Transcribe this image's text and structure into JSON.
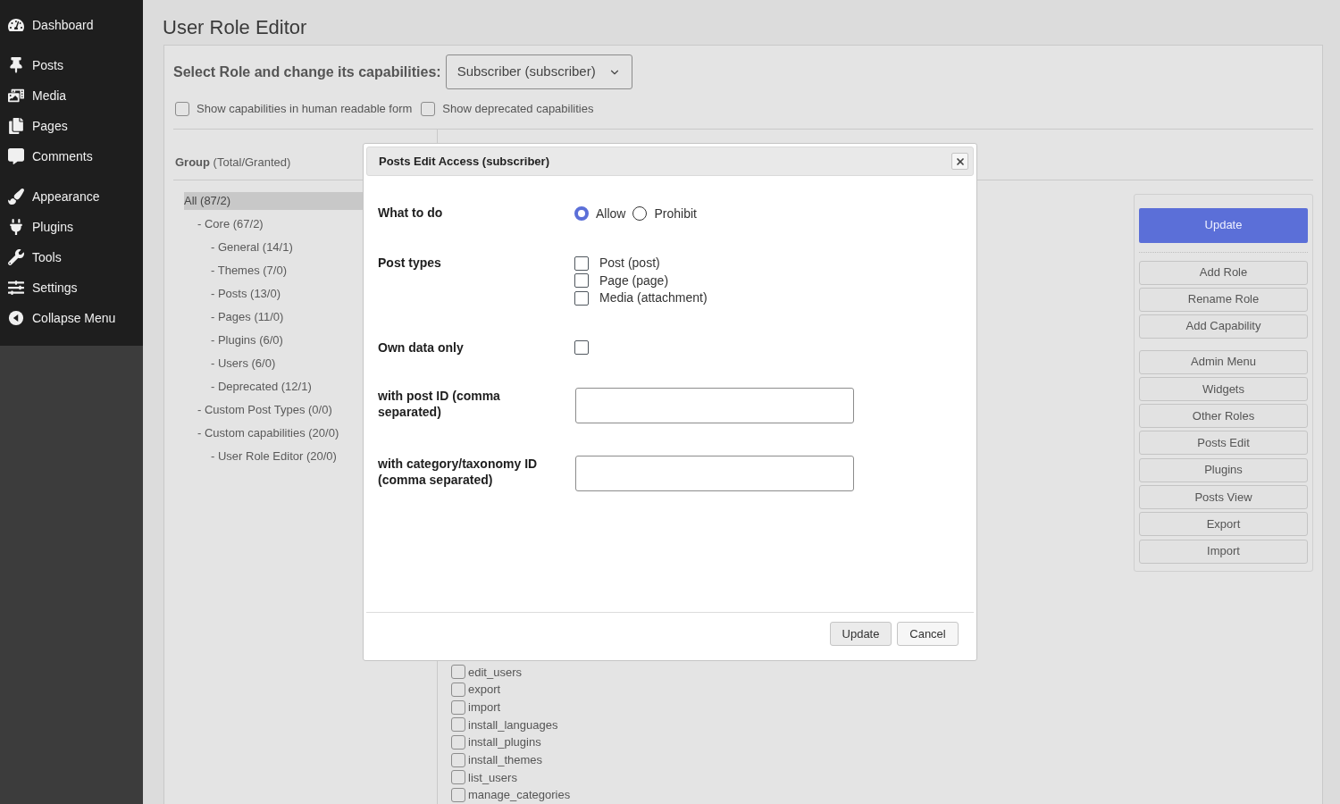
{
  "sidebar": {
    "sections": [
      {
        "items": [
          {
            "label": "Dashboard"
          }
        ]
      },
      {
        "items": [
          {
            "label": "Posts"
          },
          {
            "label": "Media"
          },
          {
            "label": "Pages"
          },
          {
            "label": "Comments"
          }
        ]
      },
      {
        "items": [
          {
            "label": "Appearance"
          },
          {
            "label": "Plugins"
          },
          {
            "label": "Tools"
          },
          {
            "label": "Settings"
          },
          {
            "label": "Collapse Menu"
          }
        ]
      }
    ]
  },
  "page": {
    "title": "User Role Editor"
  },
  "role_selector": {
    "label": "Select Role and change its capabilities:",
    "value": "Subscriber (subscriber)"
  },
  "options": [
    {
      "label": "Show capabilities in human readable form",
      "checked": false
    },
    {
      "label": "Show deprecated capabilities",
      "checked": false
    }
  ],
  "groups": {
    "heading": "**Group** (Total/Granted)",
    "tree": [
      {
        "label": "All (87/2)",
        "selected": true,
        "children": [
          {
            "label": "- Core (67/2)",
            "selected": false,
            "children": [
              {
                "label": "- General (14/1)",
                "selected": false
              },
              {
                "label": "- Themes (7/0)",
                "selected": false
              },
              {
                "label": "- Posts (13/0)",
                "selected": false
              },
              {
                "label": "- Pages (11/0)",
                "selected": false
              },
              {
                "label": "- Plugins (6/0)",
                "selected": false
              },
              {
                "label": "- Users (6/0)",
                "selected": false
              },
              {
                "label": "- Deprecated (12/1)",
                "selected": false
              }
            ]
          },
          {
            "label": "- Custom Post Types (0/0)",
            "selected": false
          },
          {
            "label": "- Custom capabilities (20/0)",
            "selected": false,
            "children": [
              {
                "label": "- User Role Editor (20/0)",
                "selected": false
              }
            ]
          }
        ]
      }
    ]
  },
  "capabilities": [
    {
      "name": "edit_users",
      "checked": false
    },
    {
      "name": "export",
      "checked": false
    },
    {
      "name": "import",
      "checked": false
    },
    {
      "name": "install_languages",
      "checked": false
    },
    {
      "name": "install_plugins",
      "checked": false
    },
    {
      "name": "install_themes",
      "checked": false
    },
    {
      "name": "list_users",
      "checked": false
    },
    {
      "name": "manage_categories",
      "checked": false
    }
  ],
  "actions": {
    "primary": "Update",
    "button_groups": [
      {
        "buttons": [
          "Add Role",
          "Rename Role",
          "Add Capability"
        ]
      },
      {
        "buttons": [
          "Admin Menu",
          "Widgets",
          "Other Roles",
          "Posts Edit",
          "Plugins",
          "Posts View",
          "Export",
          "Import"
        ]
      }
    ]
  },
  "dialog": {
    "title": "Posts Edit Access (subscriber)",
    "fields": [
      {
        "kind": "radio",
        "label": "What to do",
        "options": [
          {
            "label": "Allow",
            "selected": true
          },
          {
            "label": "Prohibit",
            "selected": false
          }
        ]
      },
      {
        "kind": "checkboxes",
        "label": "Post types",
        "options": [
          {
            "label": "Post (post)",
            "checked": false
          },
          {
            "label": "Page (page)",
            "checked": false
          },
          {
            "label": "Media (attachment)",
            "checked": false
          }
        ]
      },
      {
        "kind": "checkbox",
        "label": "Own data only",
        "checked": false
      },
      {
        "kind": "text",
        "label": "with post ID (comma separated)"
      },
      {
        "kind": "text",
        "label": "with category/taxonomy ID (comma separated)"
      }
    ],
    "buttons": [
      "Update",
      "Cancel"
    ]
  }
}
